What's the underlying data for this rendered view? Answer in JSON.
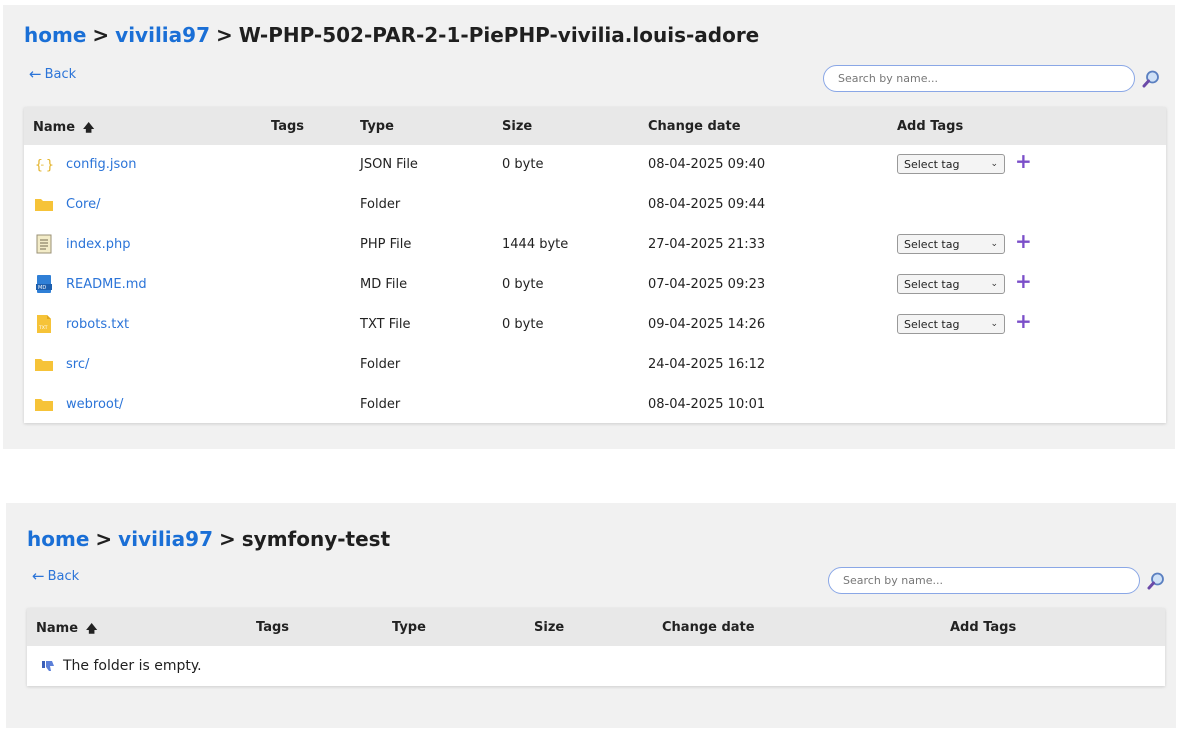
{
  "panel1": {
    "breadcrumb": {
      "home": "home",
      "user": "vivilia97",
      "current": "W-PHP-502-PAR-2-1-PiePHP-vivilia.louis-adore",
      "separator": ">"
    },
    "back_label": "Back",
    "search_placeholder": "Search by name...",
    "headers": {
      "name": "Name",
      "tags": "Tags",
      "type": "Type",
      "size": "Size",
      "date": "Change date",
      "add_tags": "Add Tags"
    },
    "rows": [
      {
        "name": "config.json",
        "icon": "json-file-icon",
        "type": "JSON File",
        "size": "0 byte",
        "date": "08-04-2025 09:40",
        "select": "Select tag"
      },
      {
        "name": "Core/",
        "icon": "folder-icon",
        "type": "Folder",
        "size": "",
        "date": "08-04-2025 09:44",
        "select": ""
      },
      {
        "name": "index.php",
        "icon": "php-file-icon",
        "type": "PHP File",
        "size": "1444 byte",
        "date": "27-04-2025 21:33",
        "select": "Select tag"
      },
      {
        "name": "README.md",
        "icon": "md-file-icon",
        "type": "MD File",
        "size": "0 byte",
        "date": "07-04-2025 09:23",
        "select": "Select tag"
      },
      {
        "name": "robots.txt",
        "icon": "txt-file-icon",
        "type": "TXT File",
        "size": "0 byte",
        "date": "09-04-2025 14:26",
        "select": "Select tag"
      },
      {
        "name": "src/",
        "icon": "folder-icon",
        "type": "Folder",
        "size": "",
        "date": "24-04-2025 16:12",
        "select": ""
      },
      {
        "name": "webroot/",
        "icon": "folder-icon",
        "type": "Folder",
        "size": "",
        "date": "08-04-2025 10:01",
        "select": ""
      }
    ]
  },
  "panel2": {
    "breadcrumb": {
      "home": "home",
      "user": "vivilia97",
      "current": "symfony-test",
      "separator": ">"
    },
    "back_label": "Back",
    "search_placeholder": "Search by name...",
    "headers": {
      "name": "Name",
      "tags": "Tags",
      "type": "Type",
      "size": "Size",
      "date": "Change date",
      "add_tags": "Add Tags"
    },
    "empty_message": "The folder is empty."
  },
  "colors": {
    "link": "#2b74d8",
    "breadcrumb_link": "#1a6fd6",
    "plus": "#7b4fc9",
    "folder": "#f6c338"
  }
}
